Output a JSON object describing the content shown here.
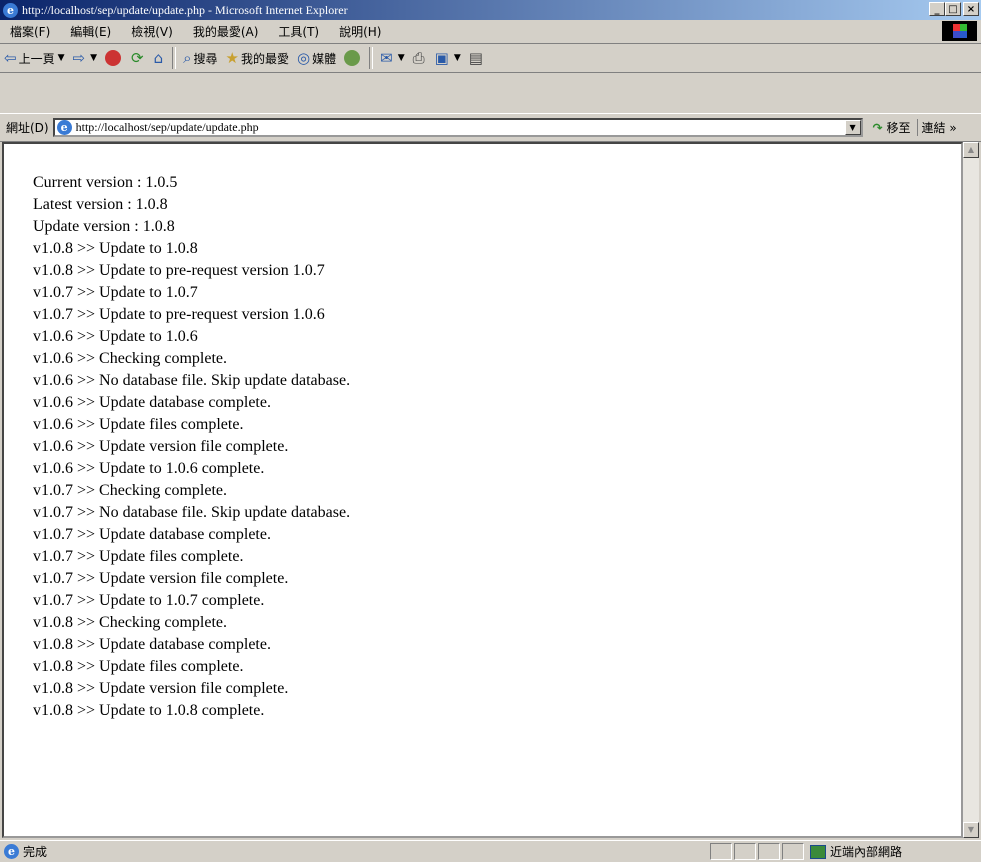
{
  "window": {
    "title": "http://localhost/sep/update/update.php - Microsoft Internet Explorer",
    "minimize": "_",
    "maximize": "□",
    "close": "×"
  },
  "menu": [
    "檔案(F)",
    "編輯(E)",
    "檢視(V)",
    "我的最愛(A)",
    "工具(T)",
    "說明(H)"
  ],
  "toolbar": {
    "back_label": "上一頁",
    "search_label": "搜尋",
    "favorites_label": "我的最愛",
    "media_label": "媒體"
  },
  "address": {
    "label": "網址(D)",
    "url": "http://localhost/sep/update/update.php",
    "go_label": "移至",
    "links_label": "連結 »"
  },
  "log_lines": [
    "Current version : 1.0.5",
    "Latest version : 1.0.8",
    "Update version : 1.0.8",
    "v1.0.8 >> Update to 1.0.8",
    "v1.0.8 >> Update to pre-request version 1.0.7",
    "v1.0.7 >> Update to 1.0.7",
    "v1.0.7 >> Update to pre-request version 1.0.6",
    "v1.0.6 >> Update to 1.0.6",
    "v1.0.6 >> Checking complete.",
    "v1.0.6 >> No database file. Skip update database.",
    "v1.0.6 >> Update database complete.",
    "v1.0.6 >> Update files complete.",
    "v1.0.6 >> Update version file complete.",
    "v1.0.6 >> Update to 1.0.6 complete.",
    "v1.0.7 >> Checking complete.",
    "v1.0.7 >> No database file. Skip update database.",
    "v1.0.7 >> Update database complete.",
    "v1.0.7 >> Update files complete.",
    "v1.0.7 >> Update version file complete.",
    "v1.0.7 >> Update to 1.0.7 complete.",
    "v1.0.8 >> Checking complete.",
    "v1.0.8 >> Update database complete.",
    "v1.0.8 >> Update files complete.",
    "v1.0.8 >> Update version file complete.",
    "v1.0.8 >> Update to 1.0.8 complete."
  ],
  "status": {
    "text": "完成",
    "zone": "近端內部網路"
  },
  "colors": {
    "titlebar_start": "#0a246a",
    "titlebar_end": "#a6caf0",
    "chrome": "#d4d0c8"
  }
}
